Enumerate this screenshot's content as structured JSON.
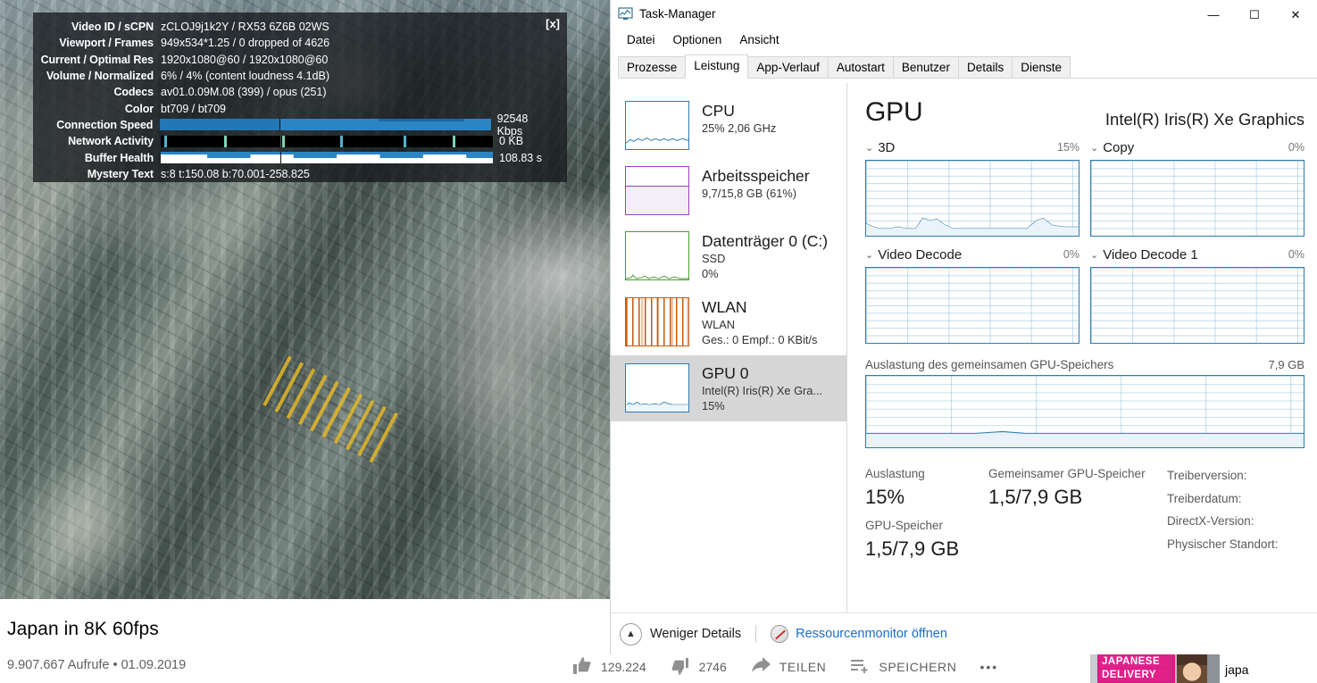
{
  "youtube": {
    "stats_overlay": {
      "close_label": "[x]",
      "rows": [
        {
          "key": "Video ID / sCPN",
          "value": "zCLOJ9j1k2Y / RX53 6Z6B 02WS"
        },
        {
          "key": "Viewport / Frames",
          "value": "949x534*1.25 / 0 dropped of 4626"
        },
        {
          "key": "Current / Optimal Res",
          "value": "1920x1080@60 / 1920x1080@60"
        },
        {
          "key": "Volume / Normalized",
          "value": "6% / 4% (content loudness 4.1dB)"
        },
        {
          "key": "Codecs",
          "value": "av01.0.09M.08 (399) / opus (251)"
        },
        {
          "key": "Color",
          "value": "bt709 / bt709"
        }
      ],
      "bars": [
        {
          "key": "Connection Speed",
          "value": "92548 Kbps"
        },
        {
          "key": "Network Activity",
          "value": "0 KB"
        },
        {
          "key": "Buffer Health",
          "value": "108.83 s"
        }
      ],
      "mystery": {
        "key": "Mystery Text",
        "value": "s:8 t:150.08 b:70.001-258.825"
      }
    },
    "title": "Japan in 8K 60fps",
    "views_date": "9.907.667 Aufrufe • 01.09.2019",
    "actions": {
      "likes": "129.224",
      "dislikes": "2746",
      "share_label": "TEILEN",
      "save_label": "SPEICHERN",
      "more_label": "•••"
    },
    "related_thumb": {
      "banner_line1": "JAPANESE",
      "banner_line2": "DELIVERY",
      "side_text": "japa"
    }
  },
  "taskmanager": {
    "window_title": "Task-Manager",
    "window_buttons": {
      "minimize": "—",
      "maximize": "☐",
      "close": "✕"
    },
    "menu": [
      "Datei",
      "Optionen",
      "Ansicht"
    ],
    "tabs": [
      {
        "label": "Prozesse",
        "active": false
      },
      {
        "label": "Leistung",
        "active": true
      },
      {
        "label": "App-Verlauf",
        "active": false
      },
      {
        "label": "Autostart",
        "active": false
      },
      {
        "label": "Benutzer",
        "active": false
      },
      {
        "label": "Details",
        "active": false
      },
      {
        "label": "Dienste",
        "active": false
      }
    ],
    "sidebar": [
      {
        "name": "CPU",
        "sub1": "25%  2,06 GHz",
        "sub2": "",
        "sub3": "",
        "color": "#2e7cb0",
        "selected": false
      },
      {
        "name": "Arbeitsspeicher",
        "sub1": "9,7/15,8 GB (61%)",
        "sub2": "",
        "sub3": "",
        "color": "#9b3fbd",
        "selected": false
      },
      {
        "name": "Datenträger 0 (C:)",
        "sub1": "SSD",
        "sub2": "0%",
        "sub3": "",
        "color": "#4e9a2f",
        "selected": false
      },
      {
        "name": "WLAN",
        "sub1": "WLAN",
        "sub2": "Ges.: 0 Empf.: 0 KBit/s",
        "sub3": "",
        "color": "#c55a11",
        "selected": false
      },
      {
        "name": "GPU 0",
        "sub1": "Intel(R) Iris(R) Xe Gra...",
        "sub2": "15%",
        "sub3": "",
        "color": "#2e7cb0",
        "selected": true
      }
    ],
    "gpu": {
      "heading": "GPU",
      "device": "Intel(R) Iris(R) Xe Graphics",
      "engines": [
        {
          "label": "3D",
          "percent": "15%"
        },
        {
          "label": "Copy",
          "percent": "0%"
        },
        {
          "label": "Video Decode",
          "percent": "0%"
        },
        {
          "label": "Video Decode 1",
          "percent": "0%"
        }
      ],
      "shared_memory": {
        "label": "Auslastung des gemeinsamen GPU-Speichers",
        "max": "7,9 GB"
      },
      "stats": {
        "utilization_label": "Auslastung",
        "utilization_value": "15%",
        "gpu_memory_label": "GPU-Speicher",
        "gpu_memory_value": "1,5/7,9 GB",
        "shared_label": "Gemeinsamer GPU-Speicher",
        "shared_value": "1,5/7,9 GB",
        "info": [
          "Treiberversion:",
          "Treiberdatum:",
          "DirectX-Version:",
          "Physischer Standort:"
        ]
      }
    },
    "footer": {
      "less_details": "Weniger Details",
      "resource_monitor": "Ressourcenmonitor öffnen"
    }
  },
  "chart_data": [
    {
      "type": "line",
      "title": "3D",
      "ylim": [
        0,
        100
      ],
      "unit": "%",
      "current": 15,
      "grid": true,
      "x": [
        0,
        5,
        10,
        15,
        20,
        25,
        30,
        35,
        40,
        45,
        50,
        55,
        60,
        65,
        70,
        75,
        80,
        85,
        90,
        95,
        100
      ],
      "values": [
        6,
        4,
        3,
        3,
        4,
        3,
        3,
        9,
        11,
        8,
        9,
        5,
        3,
        3,
        3,
        3,
        3,
        3,
        3,
        9,
        11
      ]
    },
    {
      "type": "line",
      "title": "Copy",
      "ylim": [
        0,
        100
      ],
      "unit": "%",
      "current": 0,
      "grid": true,
      "x": [
        0,
        20,
        40,
        60,
        80,
        100
      ],
      "values": [
        0,
        0,
        0,
        0,
        0,
        0
      ]
    },
    {
      "type": "line",
      "title": "Video Decode",
      "ylim": [
        0,
        100
      ],
      "unit": "%",
      "current": 0,
      "grid": true,
      "x": [
        0,
        20,
        40,
        60,
        80,
        100
      ],
      "values": [
        0,
        0,
        0,
        0,
        0,
        0
      ]
    },
    {
      "type": "line",
      "title": "Video Decode 1",
      "ylim": [
        0,
        100
      ],
      "unit": "%",
      "current": 0,
      "grid": true,
      "x": [
        0,
        20,
        40,
        60,
        80,
        100
      ],
      "values": [
        0,
        0,
        0,
        0,
        0,
        0
      ]
    },
    {
      "type": "area",
      "title": "Auslastung des gemeinsamen GPU-Speichers",
      "ylim": [
        0,
        7.9
      ],
      "unit": "GB",
      "current": 1.5,
      "grid": true,
      "x": [
        0,
        10,
        20,
        30,
        40,
        50,
        60,
        70,
        80,
        90,
        100
      ],
      "values": [
        1.5,
        1.5,
        1.5,
        1.5,
        1.52,
        1.55,
        1.5,
        1.5,
        1.5,
        1.5,
        1.5
      ]
    }
  ]
}
